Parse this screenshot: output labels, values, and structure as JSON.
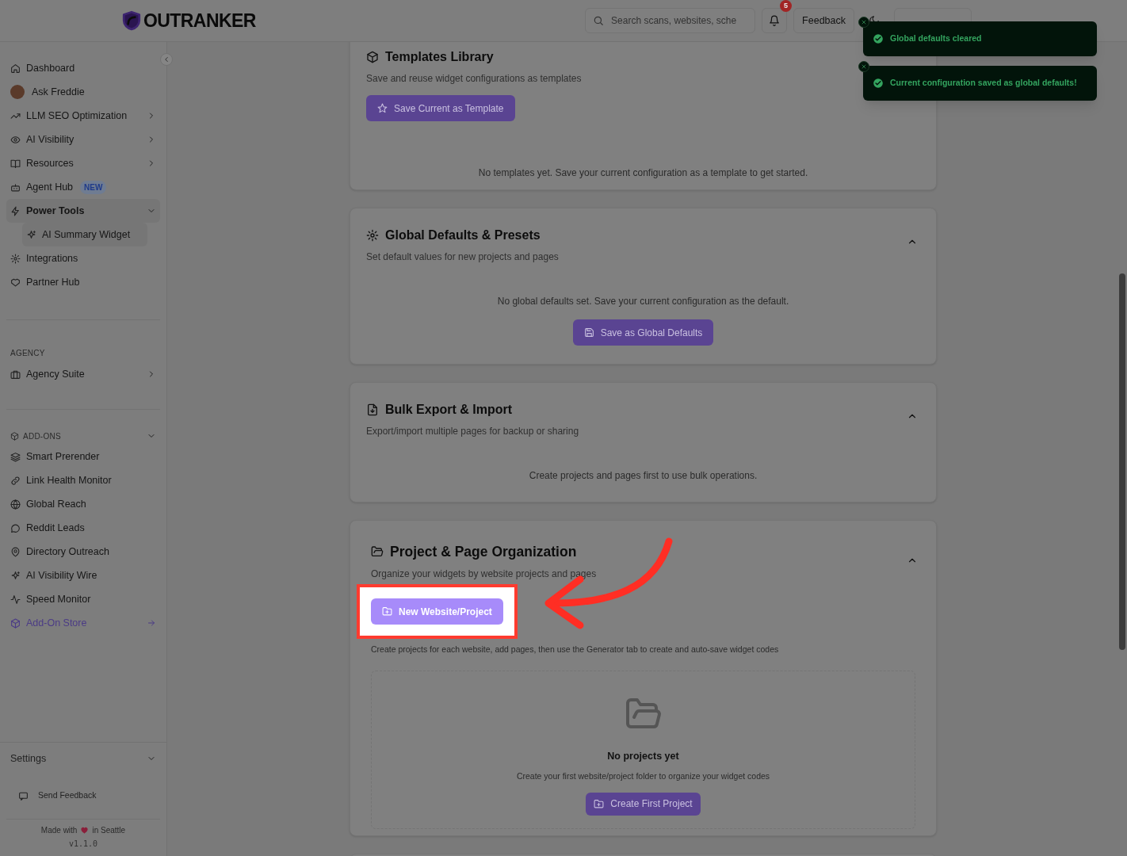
{
  "header": {
    "logo": "OUTRANKER",
    "search": {
      "placeholder": "Search scans, websites, sche"
    },
    "notifications": {
      "count": "5"
    },
    "feedback_button": "Feedback"
  },
  "toasts": [
    {
      "message": "Global defaults cleared"
    },
    {
      "message": "Current configuration saved as global defaults!"
    }
  ],
  "sidebar": {
    "items": [
      {
        "label": "Dashboard",
        "kind": "link"
      },
      {
        "label": "Ask Freddie",
        "kind": "avatar"
      },
      {
        "label": "LLM SEO Optimization",
        "kind": "menu",
        "expanded": false
      },
      {
        "label": "AI Visibility",
        "kind": "menu",
        "expanded": false
      },
      {
        "label": "Resources",
        "kind": "menu",
        "expanded": false
      },
      {
        "label": "Agent Hub",
        "kind": "link",
        "badge": "NEW"
      },
      {
        "label": "Power Tools",
        "kind": "menu",
        "expanded": true,
        "children": [
          {
            "label": "AI Summary Widget",
            "selected": true
          }
        ]
      },
      {
        "label": "Integrations",
        "kind": "link"
      },
      {
        "label": "Partner Hub",
        "kind": "link"
      }
    ],
    "agency": {
      "heading": "AGENCY",
      "items": [
        {
          "label": "Agency Suite",
          "kind": "menu",
          "expanded": false
        }
      ]
    },
    "addons": {
      "heading": "ADD-ONS",
      "expanded": true,
      "items": [
        {
          "label": "Smart Prerender"
        },
        {
          "label": "Link Health Monitor"
        },
        {
          "label": "Global Reach"
        },
        {
          "label": "Reddit Leads"
        },
        {
          "label": "Directory Outreach"
        },
        {
          "label": "AI Visibility Wire"
        },
        {
          "label": "Speed Monitor"
        }
      ],
      "store_link": "Add-On Store"
    },
    "settings": {
      "label": "Settings",
      "expanded": false
    },
    "send_feedback": "Send Feedback",
    "footer": {
      "made_with": "Made with",
      "location": "in Seattle",
      "version": "v1.1.0"
    }
  },
  "cards": [
    {
      "title": "Templates Library",
      "subtitle": "Save and reuse widget configurations as templates",
      "button": "Save Current as Template",
      "empty_text": "No templates yet. Save your current configuration as a template to get started."
    },
    {
      "title": "Global Defaults & Presets",
      "subtitle": "Set default values for new projects and pages",
      "empty_text": "No global defaults set. Save your current configuration as the default.",
      "footer_button": "Save as Global Defaults",
      "expanded": true
    },
    {
      "title": "Bulk Export & Import",
      "subtitle": "Export/import multiple pages for backup or sharing",
      "empty_text": "Create projects and pages first to use bulk operations.",
      "expanded": true
    },
    {
      "title": "Project & Page Organization",
      "subtitle": "Organize your widgets by website projects and pages",
      "highlighted_button": "New Website/Project",
      "help_text": "Create projects for each website, add pages, then use the Generator tab to create and auto-save widget codes",
      "empty_state": {
        "title": "No projects yet",
        "text": "Create your first website/project folder to organize your widget codes",
        "button": "Create First Project"
      },
      "expanded": true
    }
  ]
}
